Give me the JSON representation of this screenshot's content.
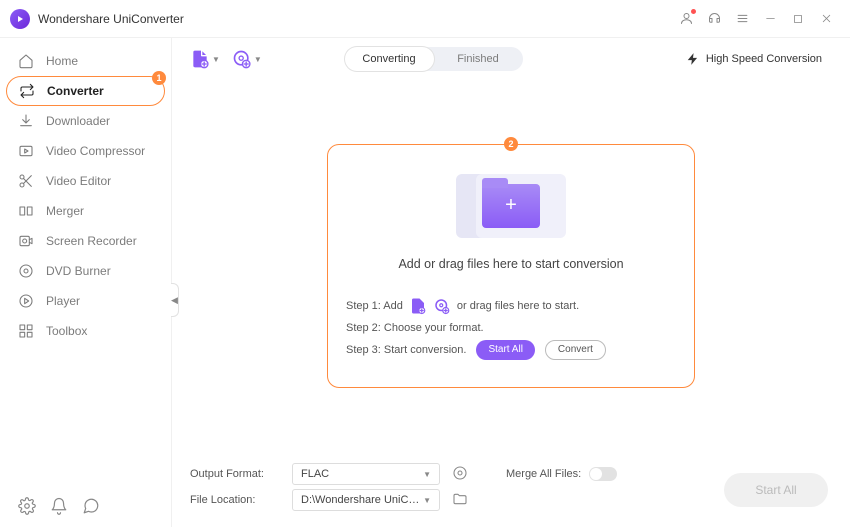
{
  "app": {
    "title": "Wondershare UniConverter"
  },
  "sidebar": {
    "items": [
      {
        "label": "Home"
      },
      {
        "label": "Converter"
      },
      {
        "label": "Downloader"
      },
      {
        "label": "Video Compressor"
      },
      {
        "label": "Video Editor"
      },
      {
        "label": "Merger"
      },
      {
        "label": "Screen Recorder"
      },
      {
        "label": "DVD Burner"
      },
      {
        "label": "Player"
      },
      {
        "label": "Toolbox"
      }
    ]
  },
  "annotations": {
    "badge1": "1",
    "badge2": "2"
  },
  "toolbar": {
    "tabs": {
      "converting": "Converting",
      "finished": "Finished"
    },
    "high_speed": "High Speed Conversion"
  },
  "dropzone": {
    "text": "Add or drag files here to start conversion",
    "step1_prefix": "Step 1: Add",
    "step1_suffix": "or drag files here to start.",
    "step2": "Step 2: Choose your format.",
    "step3": "Step 3: Start conversion.",
    "start_all": "Start All",
    "convert": "Convert"
  },
  "bottom": {
    "output_format_label": "Output Format:",
    "output_format_value": "FLAC",
    "file_location_label": "File Location:",
    "file_location_value": "D:\\Wondershare UniConverter",
    "merge_label": "Merge All Files:",
    "start_all": "Start All"
  }
}
